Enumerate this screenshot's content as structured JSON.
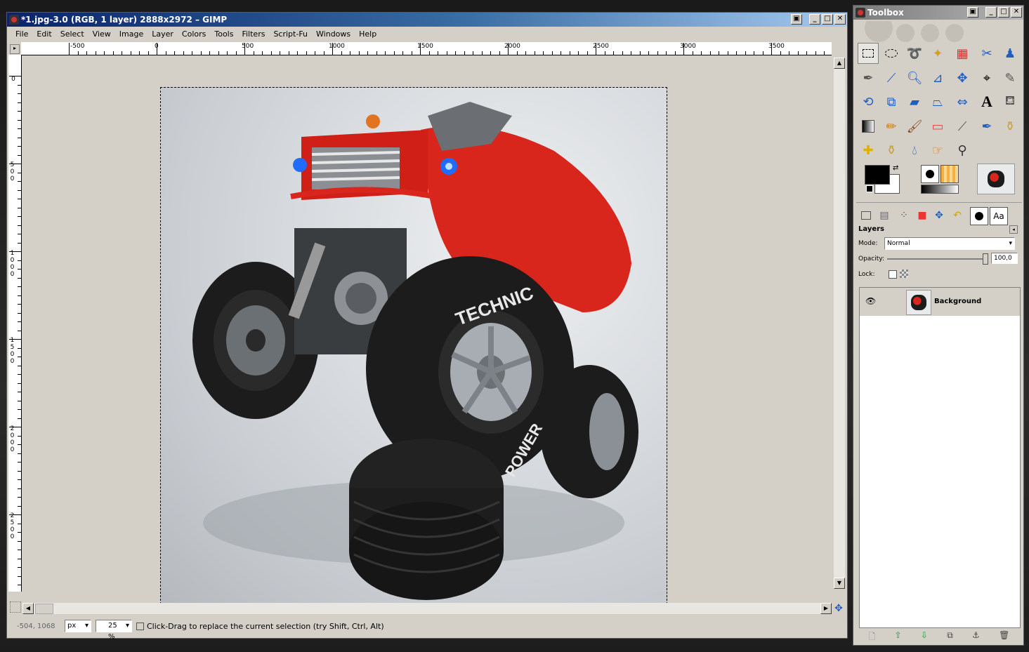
{
  "image_window": {
    "title": "*1.jpg-3.0 (RGB, 1 layer) 2888x2972 – GIMP",
    "menu": [
      "File",
      "Edit",
      "Select",
      "View",
      "Image",
      "Layer",
      "Colors",
      "Tools",
      "Filters",
      "Script-Fu",
      "Windows",
      "Help"
    ],
    "ruler_h_labels": [
      "-500",
      "0",
      "500",
      "1000",
      "1500",
      "2000",
      "2500",
      "3000",
      "3500"
    ],
    "ruler_v_labels": [
      "0",
      "500",
      "1000",
      "1500",
      "2000",
      "2500"
    ],
    "status": {
      "coords": "-504, 1068",
      "unit": "px",
      "zoom": "25 %",
      "message": "Click-Drag to replace the current selection (try Shift, Ctrl, Alt)"
    },
    "photo": {
      "tire_text_top": "TECHNIC",
      "tire_text_bottom": "POWER"
    }
  },
  "toolbox": {
    "title": "Toolbox",
    "tools": [
      "rect-select",
      "ellipse-select",
      "lasso",
      "fuzzy-select",
      "color-select",
      "scissors",
      "foreground-select",
      "paths",
      "color-picker",
      "zoom",
      "measure",
      "move",
      "align",
      "crop",
      "rotate",
      "scale",
      "shear",
      "perspective",
      "flip",
      "text",
      "bucket-fill",
      "blend",
      "pencil",
      "paintbrush",
      "eraser",
      "airbrush",
      "ink",
      "clone",
      "heal",
      "perspective-clone",
      "blur",
      "smudge",
      "dodge-burn"
    ],
    "layers": {
      "heading": "Layers",
      "mode_label": "Mode:",
      "mode_value": "Normal",
      "opacity_label": "Opacity:",
      "opacity_value": "100,0",
      "lock_label": "Lock:",
      "layer_name": "Background"
    }
  },
  "colors": {
    "accent": "#0a246a",
    "panel": "#d4d0c8",
    "tire": "#1c1c1c",
    "body_red": "#d8261c",
    "rim": "#a8adb3"
  }
}
